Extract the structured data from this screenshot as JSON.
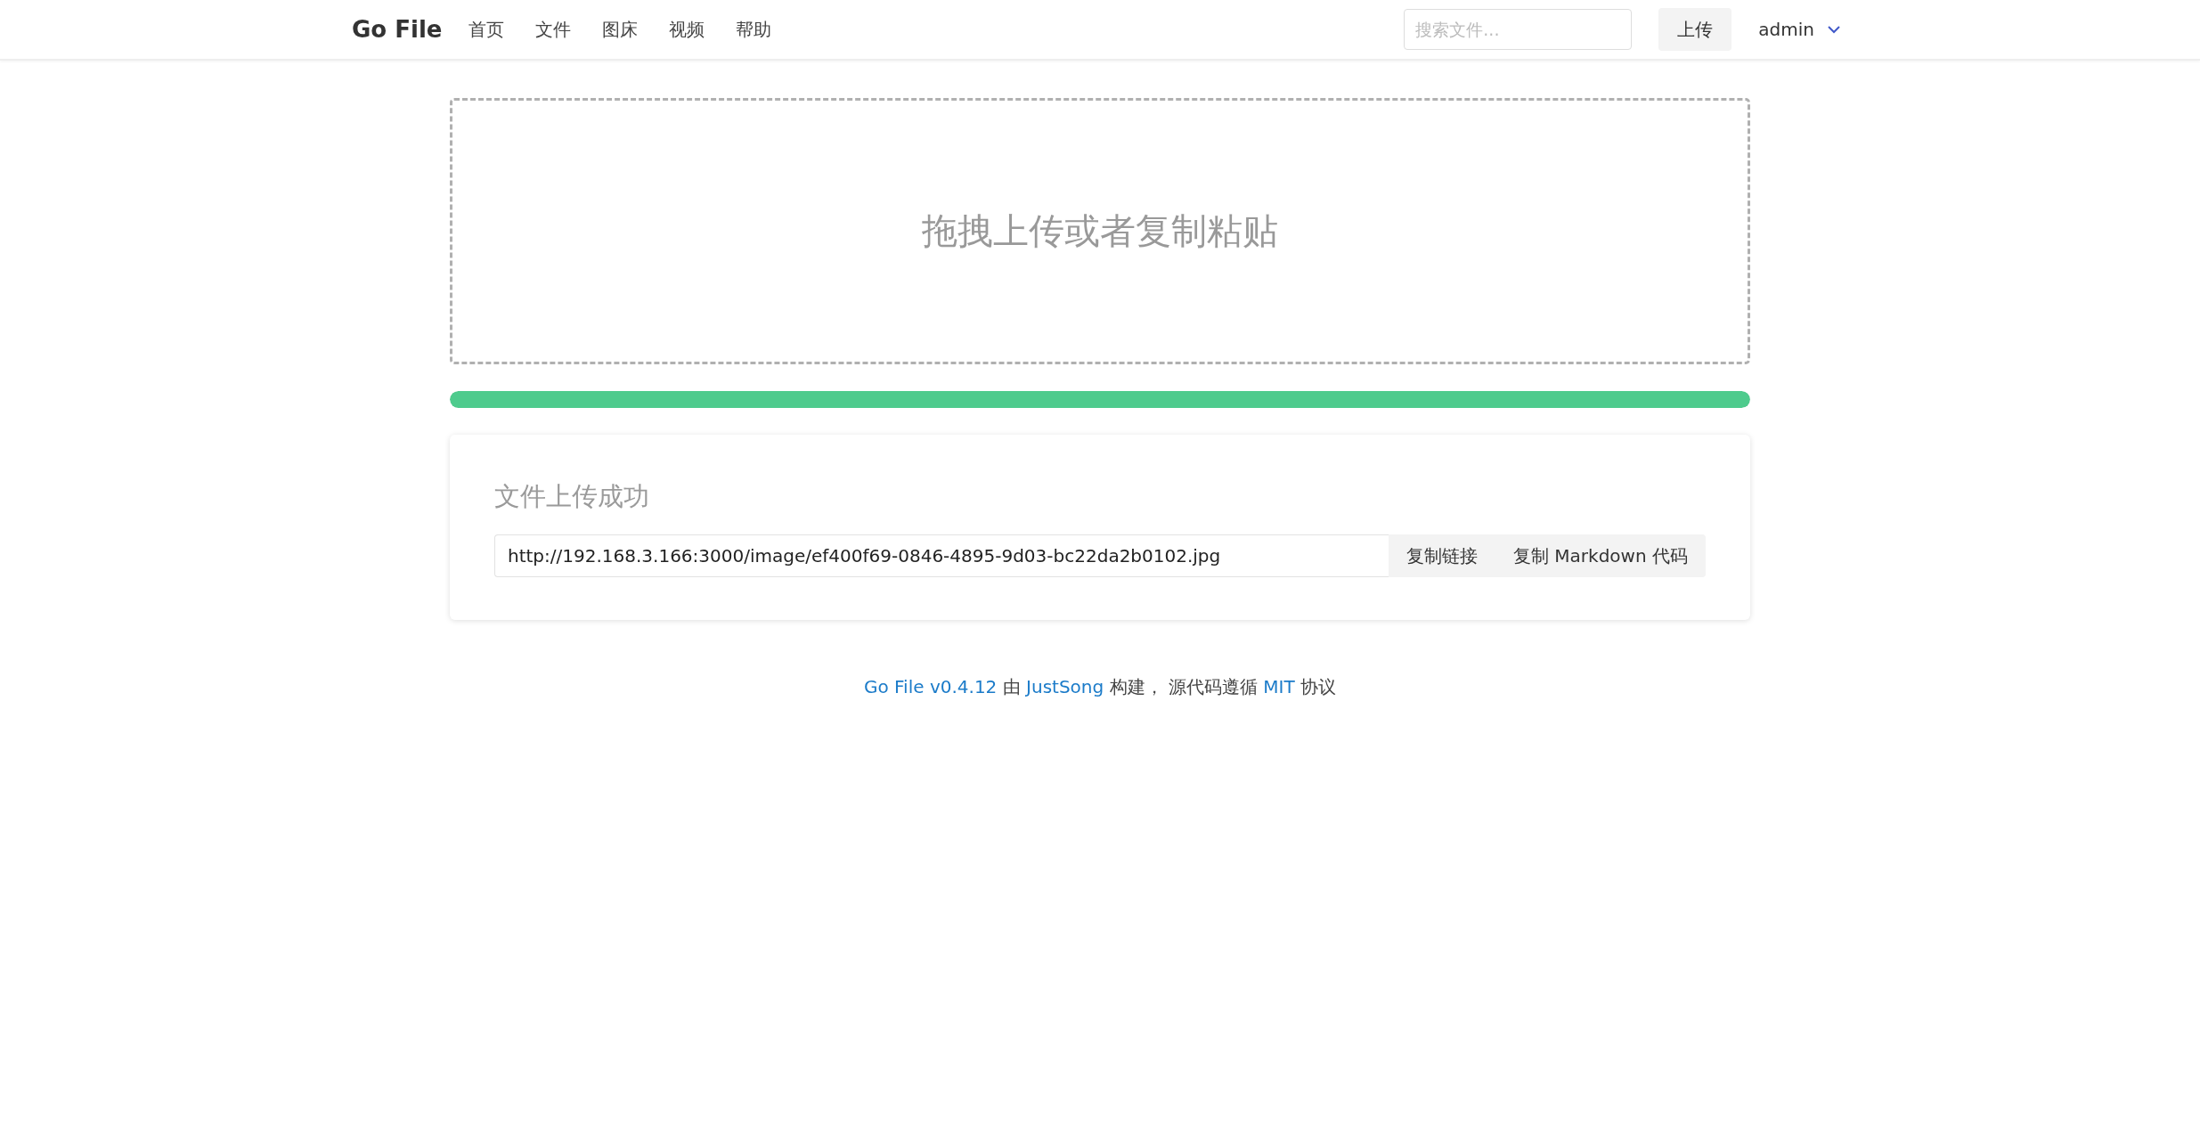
{
  "navbar": {
    "brand": "Go File",
    "items": [
      {
        "label": "首页"
      },
      {
        "label": "文件"
      },
      {
        "label": "图床"
      },
      {
        "label": "视频"
      },
      {
        "label": "帮助"
      }
    ],
    "search": {
      "placeholder": "搜索文件..."
    },
    "upload_button": "上传",
    "user": "admin"
  },
  "dropzone": {
    "text": "拖拽上传或者复制粘贴"
  },
  "progress": {
    "level": 1
  },
  "result": {
    "title": "文件上传成功",
    "url": "http://192.168.3.166:3000/image/ef400f69-0846-4895-9d03-bc22da2b0102.jpg",
    "buttons": [
      "复制链接",
      "复制 Markdown 代码"
    ]
  },
  "footer": {
    "parts": [
      {
        "text": "Go File v0.4.12",
        "link": true
      },
      {
        "text": " 由 ",
        "link": false
      },
      {
        "text": "JustSong",
        "link": true
      },
      {
        "text": " 构建， 源代码遵循 ",
        "link": false
      },
      {
        "text": "MIT",
        "link": true
      },
      {
        "text": " 协议",
        "link": false
      }
    ]
  }
}
